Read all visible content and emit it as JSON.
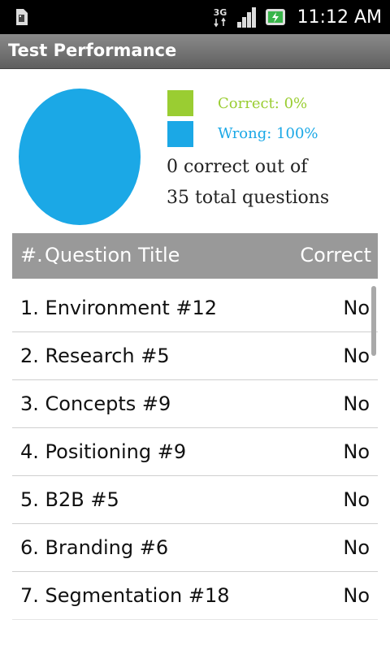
{
  "status_bar": {
    "network": "3G",
    "time": "11:12 AM"
  },
  "title_bar": {
    "title": "Test Performance"
  },
  "summary": {
    "correct_label": "Correct: 0%",
    "wrong_label": "Wrong: 100%",
    "correct_color": "#9acd32",
    "wrong_color": "#1ba8e6",
    "result_line1": "0 correct out of",
    "result_line2": "35 total questions",
    "correct_fraction": 0.0,
    "wrong_fraction": 1.0
  },
  "table": {
    "col_num": "#.",
    "col_title": "Question Title",
    "col_correct": "Correct",
    "rows": [
      {
        "question": "1. Environment #12",
        "correct": "No"
      },
      {
        "question": "2. Research #5",
        "correct": "No"
      },
      {
        "question": "3. Concepts #9",
        "correct": "No"
      },
      {
        "question": "4. Positioning #9",
        "correct": "No"
      },
      {
        "question": "5. B2B #5",
        "correct": "No"
      },
      {
        "question": "6. Branding #6",
        "correct": "No"
      },
      {
        "question": "7. Segmentation #18",
        "correct": "No"
      }
    ]
  }
}
